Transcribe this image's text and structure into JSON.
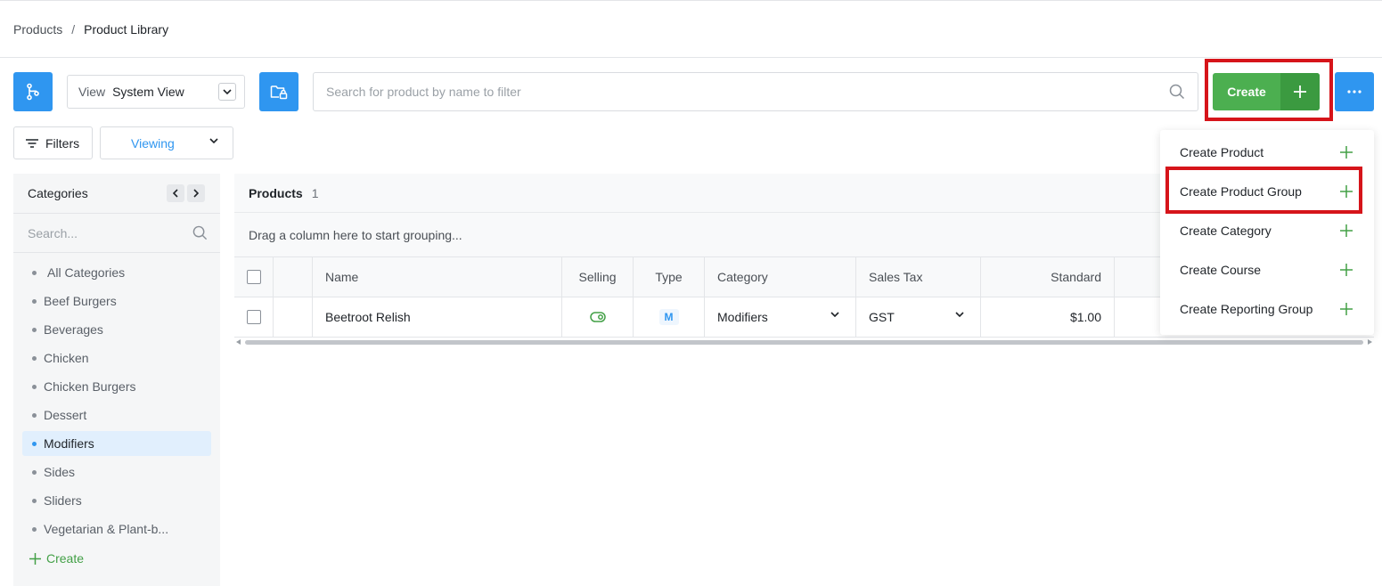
{
  "breadcrumb": {
    "parent": "Products",
    "separator": "/",
    "current": "Product Library"
  },
  "toolbar": {
    "view_label": "View",
    "view_value": "System View",
    "search_placeholder": "Search for product by name to filter",
    "create_label": "Create",
    "filters_label": "Filters",
    "viewing_label": "Viewing"
  },
  "create_menu": {
    "items": [
      {
        "label": "Create Product"
      },
      {
        "label": "Create Product Group"
      },
      {
        "label": "Create Category"
      },
      {
        "label": "Create Course"
      },
      {
        "label": "Create Reporting Group"
      }
    ],
    "highlighted": "Create Product Group"
  },
  "sidebar": {
    "title": "Categories",
    "search_placeholder": "Search...",
    "items": [
      {
        "label": "All Categories"
      },
      {
        "label": "Beef Burgers"
      },
      {
        "label": "Beverages"
      },
      {
        "label": "Chicken"
      },
      {
        "label": "Chicken Burgers"
      },
      {
        "label": "Dessert"
      },
      {
        "label": "Modifiers"
      },
      {
        "label": "Sides"
      },
      {
        "label": "Sliders"
      },
      {
        "label": "Vegetarian & Plant-b..."
      }
    ],
    "active": "Modifiers",
    "create_label": "Create"
  },
  "products": {
    "title": "Products",
    "count": "1",
    "group_hint": "Drag a column here to start grouping...",
    "columns": {
      "name": "Name",
      "selling": "Selling",
      "type": "Type",
      "category": "Category",
      "sales_tax": "Sales Tax",
      "standard": "Standard"
    },
    "rows": [
      {
        "name": "Beetroot Relish",
        "selling": true,
        "type": "M",
        "category": "Modifiers",
        "sales_tax": "GST",
        "standard": "$1.00"
      }
    ]
  },
  "colors": {
    "primary": "#2f96f0",
    "create_green": "#4caf50",
    "create_green_dark": "#3b9a40",
    "highlight_red": "#d6141a",
    "active_bg": "#e1effd"
  },
  "icons": {
    "branch": "branch-icon",
    "folder_lock": "folder-lock-icon",
    "more": "more-horizontal-icon",
    "search": "search-icon",
    "plus": "plus-icon",
    "filter": "filter-icon",
    "chevron_down": "chevron-down-icon",
    "toggle": "toggle-on-icon"
  }
}
